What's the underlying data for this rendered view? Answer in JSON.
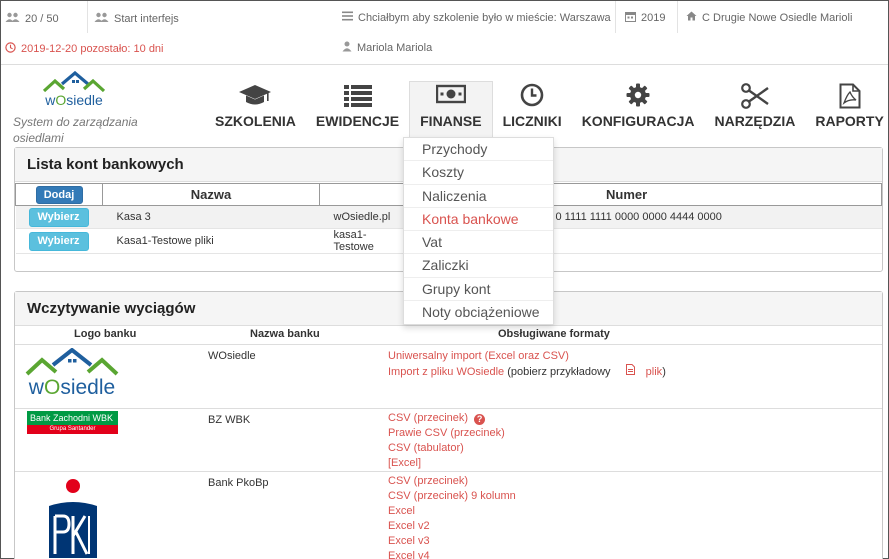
{
  "topbar": {
    "users_count": "20 / 50",
    "start_link": "Start interfejs",
    "training_city": "Chciałbym aby szkolenie było w mieście: Warszawa",
    "year": "2019",
    "estate": "C Drugie Nowe Osiedle Marioli",
    "expiry": "2019-12-20 pozostało: 10 dni",
    "user": "Mariola Mariola"
  },
  "logo": {
    "brand": "wOsiedle",
    "tagline": "System do zarządzania osiedlami"
  },
  "nav": {
    "items": [
      {
        "label": "SZKOLENIA",
        "icon": "graduation-cap-icon"
      },
      {
        "label": "EWIDENCJE",
        "icon": "list-icon"
      },
      {
        "label": "FINANSE",
        "icon": "money-icon"
      },
      {
        "label": "LICZNIKI",
        "icon": "clock-icon"
      },
      {
        "label": "KONFIGURACJA",
        "icon": "gear-icon"
      },
      {
        "label": "NARZĘDZIA",
        "icon": "scissors-icon"
      },
      {
        "label": "RAPORTY",
        "icon": "pdf-icon"
      }
    ]
  },
  "finance_menu": [
    "Przychody",
    "Koszty",
    "Naliczenia",
    "Konta bankowe",
    "Vat",
    "Zaliczki",
    "Grupy kont",
    "Noty obciążeniowe"
  ],
  "accounts": {
    "title": "Lista kont bankowych",
    "add_label": "Dodaj",
    "columns": [
      "Nazwa",
      "",
      "Numer"
    ],
    "select_label": "Wybierz",
    "rows": [
      {
        "name": "Kasa 3",
        "bank": "wOsiedle.pl",
        "number": "0 1111 1111 0000 0000 4444 0000"
      },
      {
        "name": "Kasa1-Testowe pliki",
        "bank": "kasa1-Testowe",
        "number": ""
      }
    ]
  },
  "statements": {
    "title": "Wczytywanie wyciągów",
    "columns": [
      "Logo banku",
      "Nazwa banku",
      "Obsługiwane formaty"
    ],
    "banks": [
      {
        "name": "WOsiedle",
        "formats": [
          "Uniwersalny import (Excel oraz CSV)"
        ],
        "import_prefix": "Import z pliku WOsiedle",
        "import_mid": "(pobierz przykładowy",
        "import_link": "plik",
        "import_end": ")"
      },
      {
        "name": "BZ WBK",
        "logo_text": "Bank Zachodni WBK",
        "logo_sub": "Grupa Santander",
        "formats": [
          "CSV (przecinek)",
          "Prawie CSV (przecinek)",
          "CSV (tabulator)",
          "[Excel]"
        ]
      },
      {
        "name": "Bank PkoBp",
        "formats": [
          "CSV (przecinek)",
          "CSV (przecinek) 9 kolumn",
          "Excel",
          "Excel v2",
          "Excel v3",
          "Excel v4"
        ]
      }
    ]
  },
  "colors": {
    "accent_red": "#d9534f",
    "btn_blue": "#337ab7",
    "btn_cyan": "#5bc0de",
    "logo_green": "#5aa632",
    "logo_blue": "#1f5f9e"
  }
}
